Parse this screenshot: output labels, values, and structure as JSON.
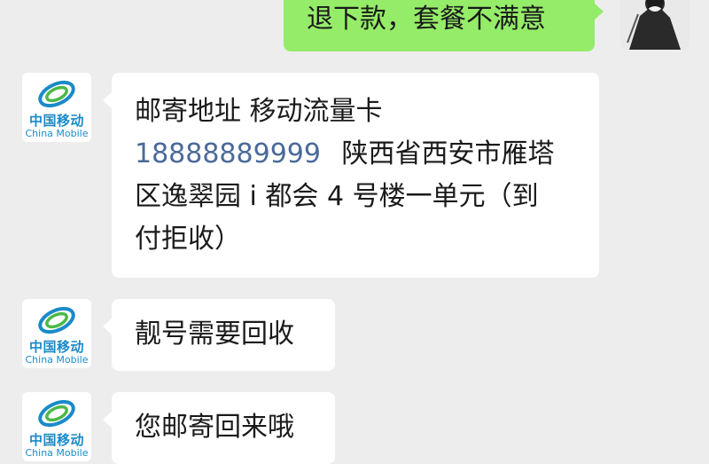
{
  "colors": {
    "background": "#ededed",
    "incoming_bubble": "#ffffff",
    "outgoing_bubble": "#95ec69",
    "brand_blue": "#1a8ac9",
    "phone_link": "#4a6a9a"
  },
  "contact": {
    "avatar_cn": "中国移动",
    "avatar_en": "China Mobile",
    "avatar_icon": "china-mobile-logo-icon"
  },
  "messages": [
    {
      "from": "me",
      "text": "退下款，套餐不满意"
    },
    {
      "from": "contact",
      "line1": "邮寄地址 移动流量卡",
      "phone": "18888889999",
      "after_phone": "陕西省西安市雁塔",
      "line3": "区逸翠园 i 都会 4 号楼一单元（到",
      "line4": "付拒收）"
    },
    {
      "from": "contact",
      "text": "靓号需要回收"
    },
    {
      "from": "contact",
      "text": "您邮寄回来哦"
    }
  ]
}
